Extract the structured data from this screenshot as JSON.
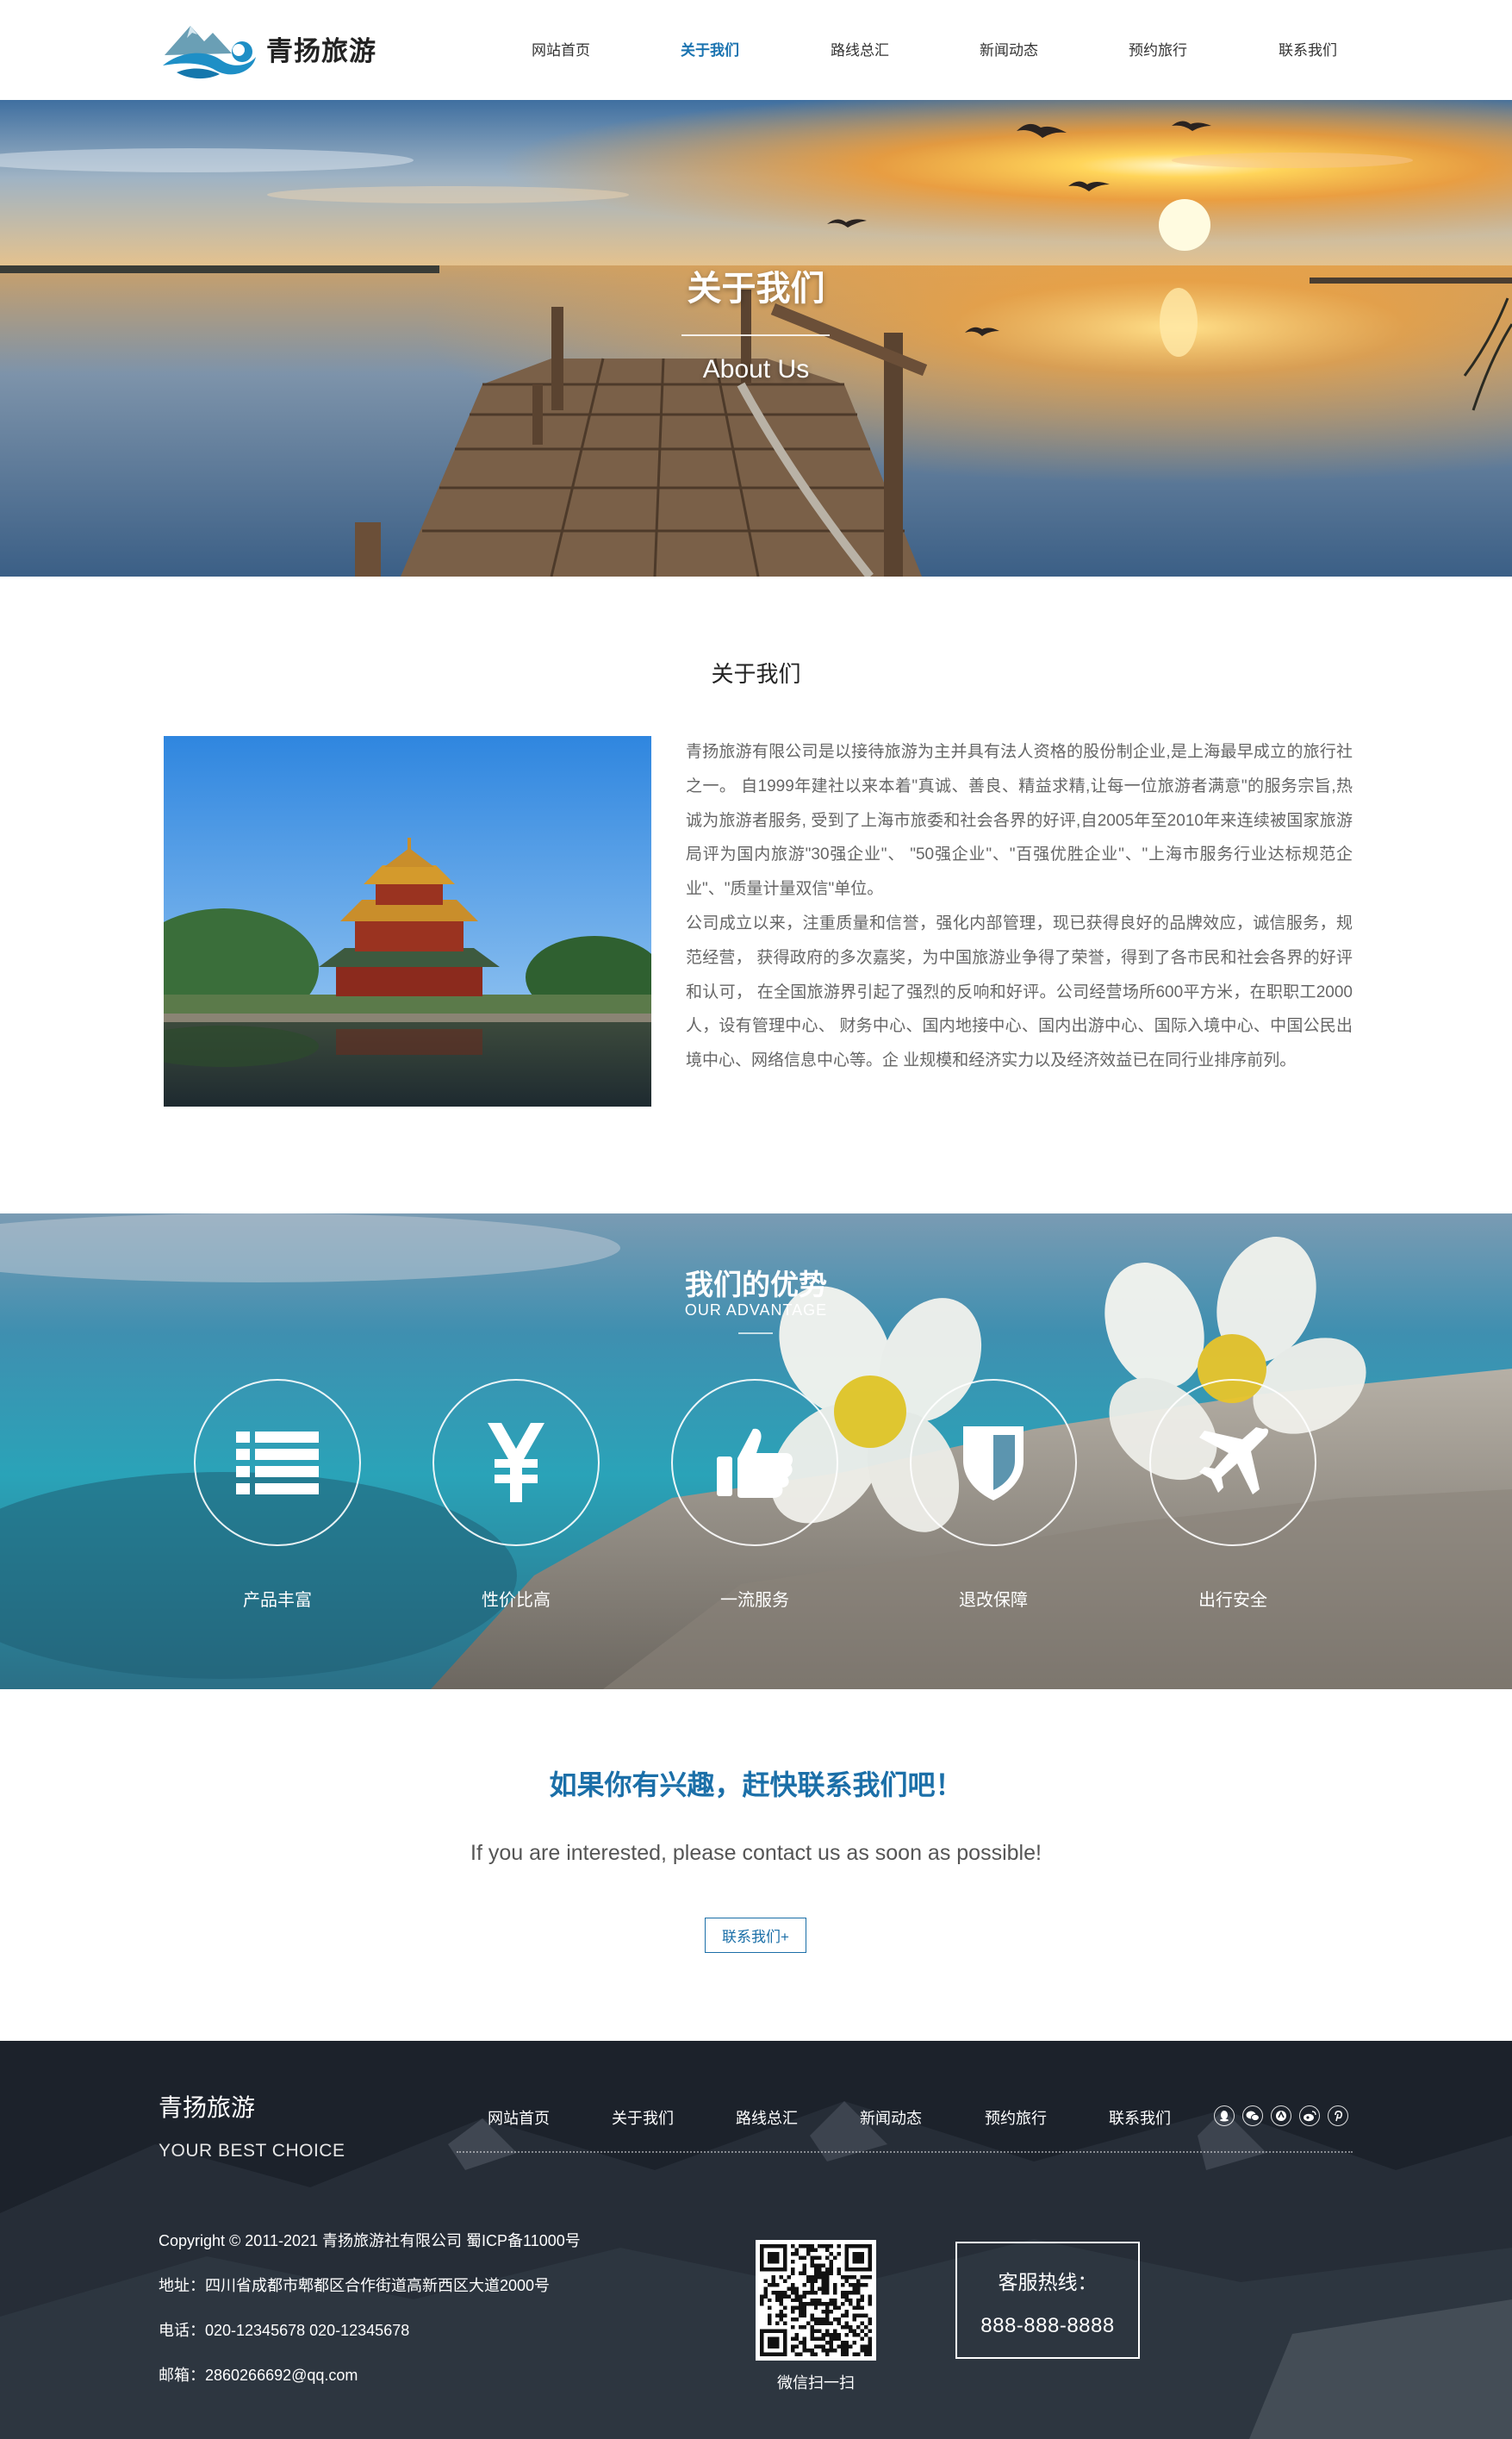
{
  "header": {
    "logo_text": "青扬旅游",
    "nav": [
      {
        "label": "网站首页",
        "active": false
      },
      {
        "label": "关于我们",
        "active": true
      },
      {
        "label": "路线总汇",
        "active": false
      },
      {
        "label": "新闻动态",
        "active": false
      },
      {
        "label": "预约旅行",
        "active": false
      },
      {
        "label": "联系我们",
        "active": false
      }
    ],
    "accent_color": "#1a73b0"
  },
  "hero": {
    "title": "关于我们",
    "subtitle": "About Us"
  },
  "about": {
    "heading": "关于我们",
    "paragraphs": [
      "青扬旅游有限公司是以接待旅游为主并具有法人资格的股份制企业,是上海最早成立的旅行社之一。 自1999年建社以来本着\"真诚、善良、精益求精,让每一位旅游者满意\"的服务宗旨,热诚为旅游者服务, 受到了上海市旅委和社会各界的好评,自2005年至2010年来连续被国家旅游局评为国内旅游\"30强企业\"、 \"50强企业\"、\"百强优胜企业\"、\"上海市服务行业达标规范企业\"、\"质量计量双信\"单位。",
      "公司成立以来，注重质量和信誉，强化内部管理，现已获得良好的品牌效应，诚信服务，规范经营， 获得政府的多次嘉奖，为中国旅游业争得了荣誉，得到了各市民和社会各界的好评和认可， 在全国旅游界引起了强烈的反响和好评。公司经营场所600平方米，在职职工2000人，设有管理中心、 财务中心、国内地接中心、国内出游中心、国际入境中心、中国公民出境中心、网络信息中心等。企 业规模和经济实力以及经济效益已在同行业排序前列。"
    ]
  },
  "advantages": {
    "title": "我们的优势",
    "subtitle": "OUR ADVANTAGE",
    "items": [
      {
        "label": "产品丰富",
        "icon": "list-icon"
      },
      {
        "label": "性价比高",
        "icon": "yen-icon"
      },
      {
        "label": "一流服务",
        "icon": "thumbs-up-icon"
      },
      {
        "label": "退改保障",
        "icon": "shield-icon"
      },
      {
        "label": "出行安全",
        "icon": "airplane-icon"
      }
    ]
  },
  "cta": {
    "title": "如果你有兴趣，赶快联系我们吧！",
    "subtitle": "If you are interested, please contact us as soon as possible!",
    "button_label": "联系我们+"
  },
  "footer": {
    "brand": "青扬旅游",
    "slogan": "YOUR BEST CHOICE",
    "nav": [
      "网站首页",
      "关于我们",
      "路线总汇",
      "新闻动态",
      "预约旅行",
      "联系我们"
    ],
    "social_icons": [
      "qq-icon",
      "wechat-icon",
      "alipay-icon",
      "weibo-icon",
      "pinterest-icon"
    ],
    "copyright": "Copyright © 2011-2021 青扬旅游社有限公司 蜀ICP备11000号",
    "address": "地址：四川省成都市郫都区合作街道高新西区大道2000号",
    "phone": "电话：020-12345678 020-12345678",
    "email": "邮箱：2860266692@qq.com",
    "qr_label": "微信扫一扫",
    "hotline_label": "客服热线：",
    "hotline_number": "888-888-8888"
  }
}
